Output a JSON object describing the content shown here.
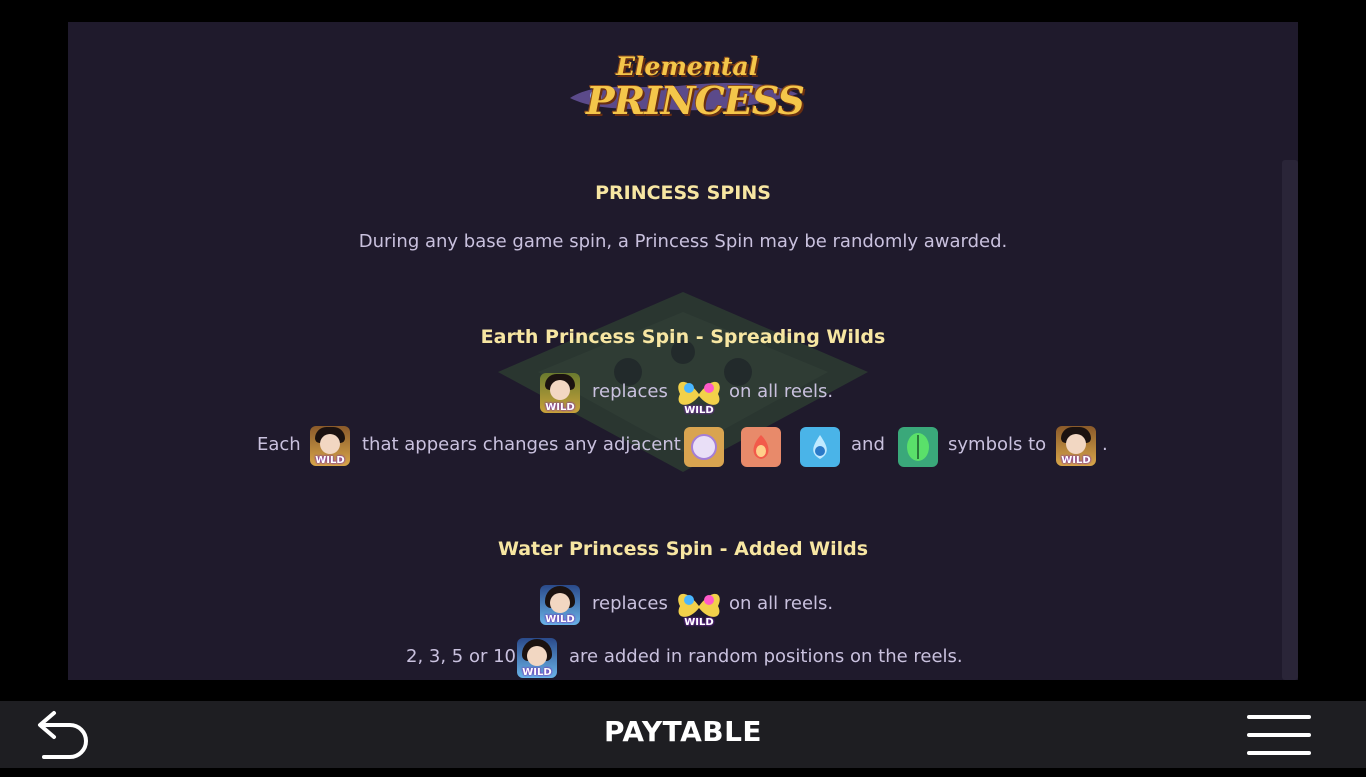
{
  "logo": {
    "line1": "Elemental",
    "line2": "PRINCESS"
  },
  "colors": {
    "panel_bg": "#1f1a2c",
    "heading": "#f7e6a2",
    "body_text": "#c9c1de",
    "bar_bg": "#1e1e22"
  },
  "sections": {
    "princess_spins": {
      "heading": "PRINCESS SPINS",
      "text": "During any base game spin, a Princess Spin may be randomly awarded."
    },
    "earth": {
      "heading": "Earth Princess Spin - Spreading Wilds",
      "replaces": "replaces",
      "on_all_reels": "on all reels.",
      "each": "Each",
      "that_appears": "that appears changes any adjacent",
      "and": "and",
      "symbols_to": "symbols to",
      "period": "."
    },
    "water": {
      "heading": "Water Princess Spin - Added Wilds",
      "replaces": "replaces",
      "on_all_reels": "on all reels.",
      "counts": "2, 3, 5 or 10",
      "added_text": "are added in random positions on the reels."
    }
  },
  "symbols": {
    "wild_label": "WILD",
    "icons": [
      "earth-wild-icon",
      "butterfly-wild-icon",
      "water-wild-icon",
      "moon-symbol-icon",
      "fire-symbol-icon",
      "water-drop-symbol-icon",
      "leaf-symbol-icon"
    ]
  },
  "bottom_bar": {
    "title": "PAYTABLE",
    "back_icon": "back-arrow-icon",
    "menu_icon": "hamburger-menu-icon"
  }
}
